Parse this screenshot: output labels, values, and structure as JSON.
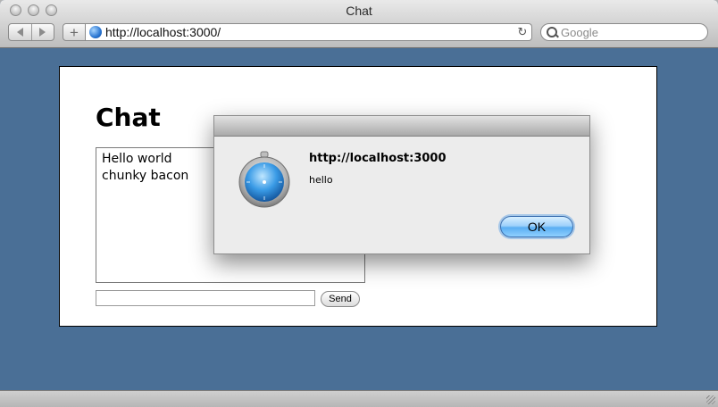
{
  "browser": {
    "window_title": "Chat",
    "url": "http://localhost:3000/",
    "search_placeholder": "Google"
  },
  "page": {
    "heading": "Chat",
    "messages": [
      "Hello world",
      "chunky bacon"
    ],
    "message_input_value": "",
    "send_label": "Send"
  },
  "dialog": {
    "title": "http://localhost:3000",
    "message": "hello",
    "ok_label": "OK",
    "icon": "safari-compass-icon"
  },
  "colors": {
    "desktop_background": "#4a6f96",
    "ok_button": "#5aaef2"
  }
}
